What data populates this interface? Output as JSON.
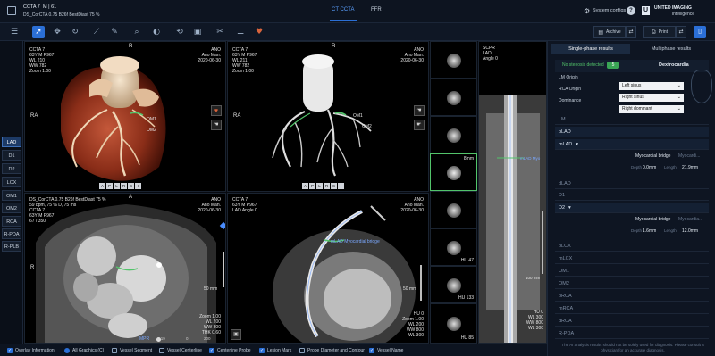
{
  "header": {
    "patient_name": "CCTA 7",
    "patient_info": "M | 61",
    "series": "DS_CorCTA 0.75 B26f BestDiast 75 %",
    "tabs": [
      {
        "label": "CT CCTA",
        "active": true
      },
      {
        "label": "FFR",
        "active": false
      }
    ],
    "system_configs": "System configs",
    "help": "?",
    "brand_line1": "UNITED IMAGING",
    "brand_line2": "intelligence",
    "logo_mark": "U"
  },
  "toolbar": {
    "icons": [
      "list-icon",
      "cursor-icon",
      "crosshair-icon",
      "rotate-icon",
      "measure-icon",
      "pencil-icon",
      "magnifier-icon",
      "window-level-icon",
      "rotate-3d-icon",
      "image-icon",
      "scissors-icon",
      "wand-icon",
      "heart-icon"
    ],
    "archive_label": "Archive",
    "print_label": "Print"
  },
  "vessel_nav": [
    "LAD",
    "D1",
    "D2",
    "LCX",
    "OM1",
    "OM2",
    "RCA",
    "R-PDA",
    "R-PLB"
  ],
  "vessel_nav_active": "LAD",
  "viewports": {
    "vr": {
      "tl": [
        "CCTA 7",
        "63Y M P967",
        "WL 210",
        "WW 782",
        "Zoom 1.00"
      ],
      "tr": [
        "ANO",
        "Ano Man.",
        "2020-06-30"
      ],
      "R": "R",
      "RA": "RA",
      "labels": {
        "om1": "OM1",
        "om2": "OM2"
      },
      "bottom_buttons": [
        "A",
        "P",
        "L",
        "R",
        "S",
        "I"
      ]
    },
    "tree": {
      "tl": [
        "CCTA 7",
        "63Y M P967",
        "WL 211",
        "WW 782",
        "Zoom 1.00"
      ],
      "tr": [
        "ANO",
        "Ano Man.",
        "2020-06-30"
      ],
      "R": "R",
      "RA": "RA",
      "labels": {
        "om1": "OM1",
        "om2": "OM2"
      },
      "bottom_buttons": [
        "A",
        "P",
        "L",
        "R",
        "S",
        "I"
      ]
    },
    "axial": {
      "tl": [
        "DS_CorCTA 0.75 B26f BestDiast 75 %",
        "59 bpm, 75 % D, 75 ms",
        "CCTA 7",
        "63Y M P967",
        "67 / 350"
      ],
      "tr": [
        "ANO",
        "Ano Man.",
        "2020-06-30"
      ],
      "A": "A",
      "R": "R",
      "scale": "50 mm",
      "br": [
        "Zoom 1.00",
        "WL 200",
        "WW 800",
        "THK 0.60"
      ],
      "mpr_label": "MPR",
      "mpr_value": "0.19",
      "slider_min": "0",
      "slider_max": "200"
    },
    "curved": {
      "tl": [
        "CCTA 7",
        "63Y M P967",
        "LAD Angle 0"
      ],
      "tr": [
        "ANO",
        "Ano Man.",
        "2020-06-30"
      ],
      "annotation": "mLAD Myocardial bridge",
      "scale": "50 mm",
      "br": [
        "HU 0",
        "Zoom 1.00",
        "WL 200",
        "WW 800",
        "WL 300"
      ]
    },
    "cross_sections": [
      {
        "label": ""
      },
      {
        "label": ""
      },
      {
        "label": ""
      },
      {
        "label": "8mm"
      },
      {
        "label": ""
      },
      {
        "label": "HU 47"
      },
      {
        "label": "HU 133"
      },
      {
        "label": "HU 85"
      }
    ],
    "scpr": {
      "tl": [
        "SCPR",
        "LAD",
        "Angle 0"
      ],
      "annotation": "mLAD Myo",
      "scale": "100 mm",
      "br": [
        "HU 0",
        "WL 300",
        "WW 800",
        "WL 300"
      ]
    }
  },
  "bottom_options": [
    {
      "label": "Overlay Information",
      "checked": true,
      "type": "checkbox"
    },
    {
      "label": "All Graphics (C)",
      "checked": true,
      "type": "radio"
    },
    {
      "label": "Vessel Segment",
      "checked": false,
      "type": "checkbox"
    },
    {
      "label": "Vessel Centerline",
      "checked": false,
      "type": "checkbox"
    },
    {
      "label": "Centerline Probe",
      "checked": true,
      "type": "checkbox"
    },
    {
      "label": "Lesion Mark",
      "checked": true,
      "type": "checkbox"
    },
    {
      "label": "Probe Diameter and Contour",
      "checked": false,
      "type": "checkbox"
    },
    {
      "label": "Vessel Name",
      "checked": true,
      "type": "checkbox"
    }
  ],
  "results": {
    "tabs": [
      {
        "label": "Single-phase results",
        "active": true
      },
      {
        "label": "Multiphase results",
        "active": false
      }
    ],
    "stenosis": "No stenosis detected",
    "stenosis_badge": "5",
    "dextrocardia": "Dextrocardia",
    "fields": [
      {
        "label": "LM Origin",
        "value": "Left sinus"
      },
      {
        "label": "RCA Origin",
        "value": "Right sinus"
      },
      {
        "label": "Dominance",
        "value": "Right dominant"
      }
    ],
    "segments_top": [
      "LM",
      "pLAD"
    ],
    "mlad": {
      "name": "mLAD",
      "finding": "Myocardial bridge",
      "finding_more": "Myocardi...",
      "depth_label": "Depth",
      "depth": "0.0mm",
      "length_label": "Length",
      "length": "21.9mm"
    },
    "segments_mid": [
      "dLAD",
      "D1"
    ],
    "d2": {
      "name": "D2",
      "finding": "Myocardial bridge",
      "finding_more": "Myocardia...",
      "depth_label": "Depth",
      "depth": "1.6mm",
      "length_label": "Length",
      "length": "12.0mm"
    },
    "segments_bottom": [
      "pLCX",
      "mLCX",
      "OM1",
      "OM2",
      "pRCA",
      "mRCA",
      "dRCA",
      "R-PDA"
    ],
    "disclaimer": "The AI analysis results should not be solely used for diagnosis. Please consult a physician for an accurate diagnosis."
  },
  "colors": {
    "accent": "#2b6fd6",
    "badge_green": "#3aa655",
    "vessel_red": "#b3402a",
    "stenosis_green": "#52c46a"
  }
}
